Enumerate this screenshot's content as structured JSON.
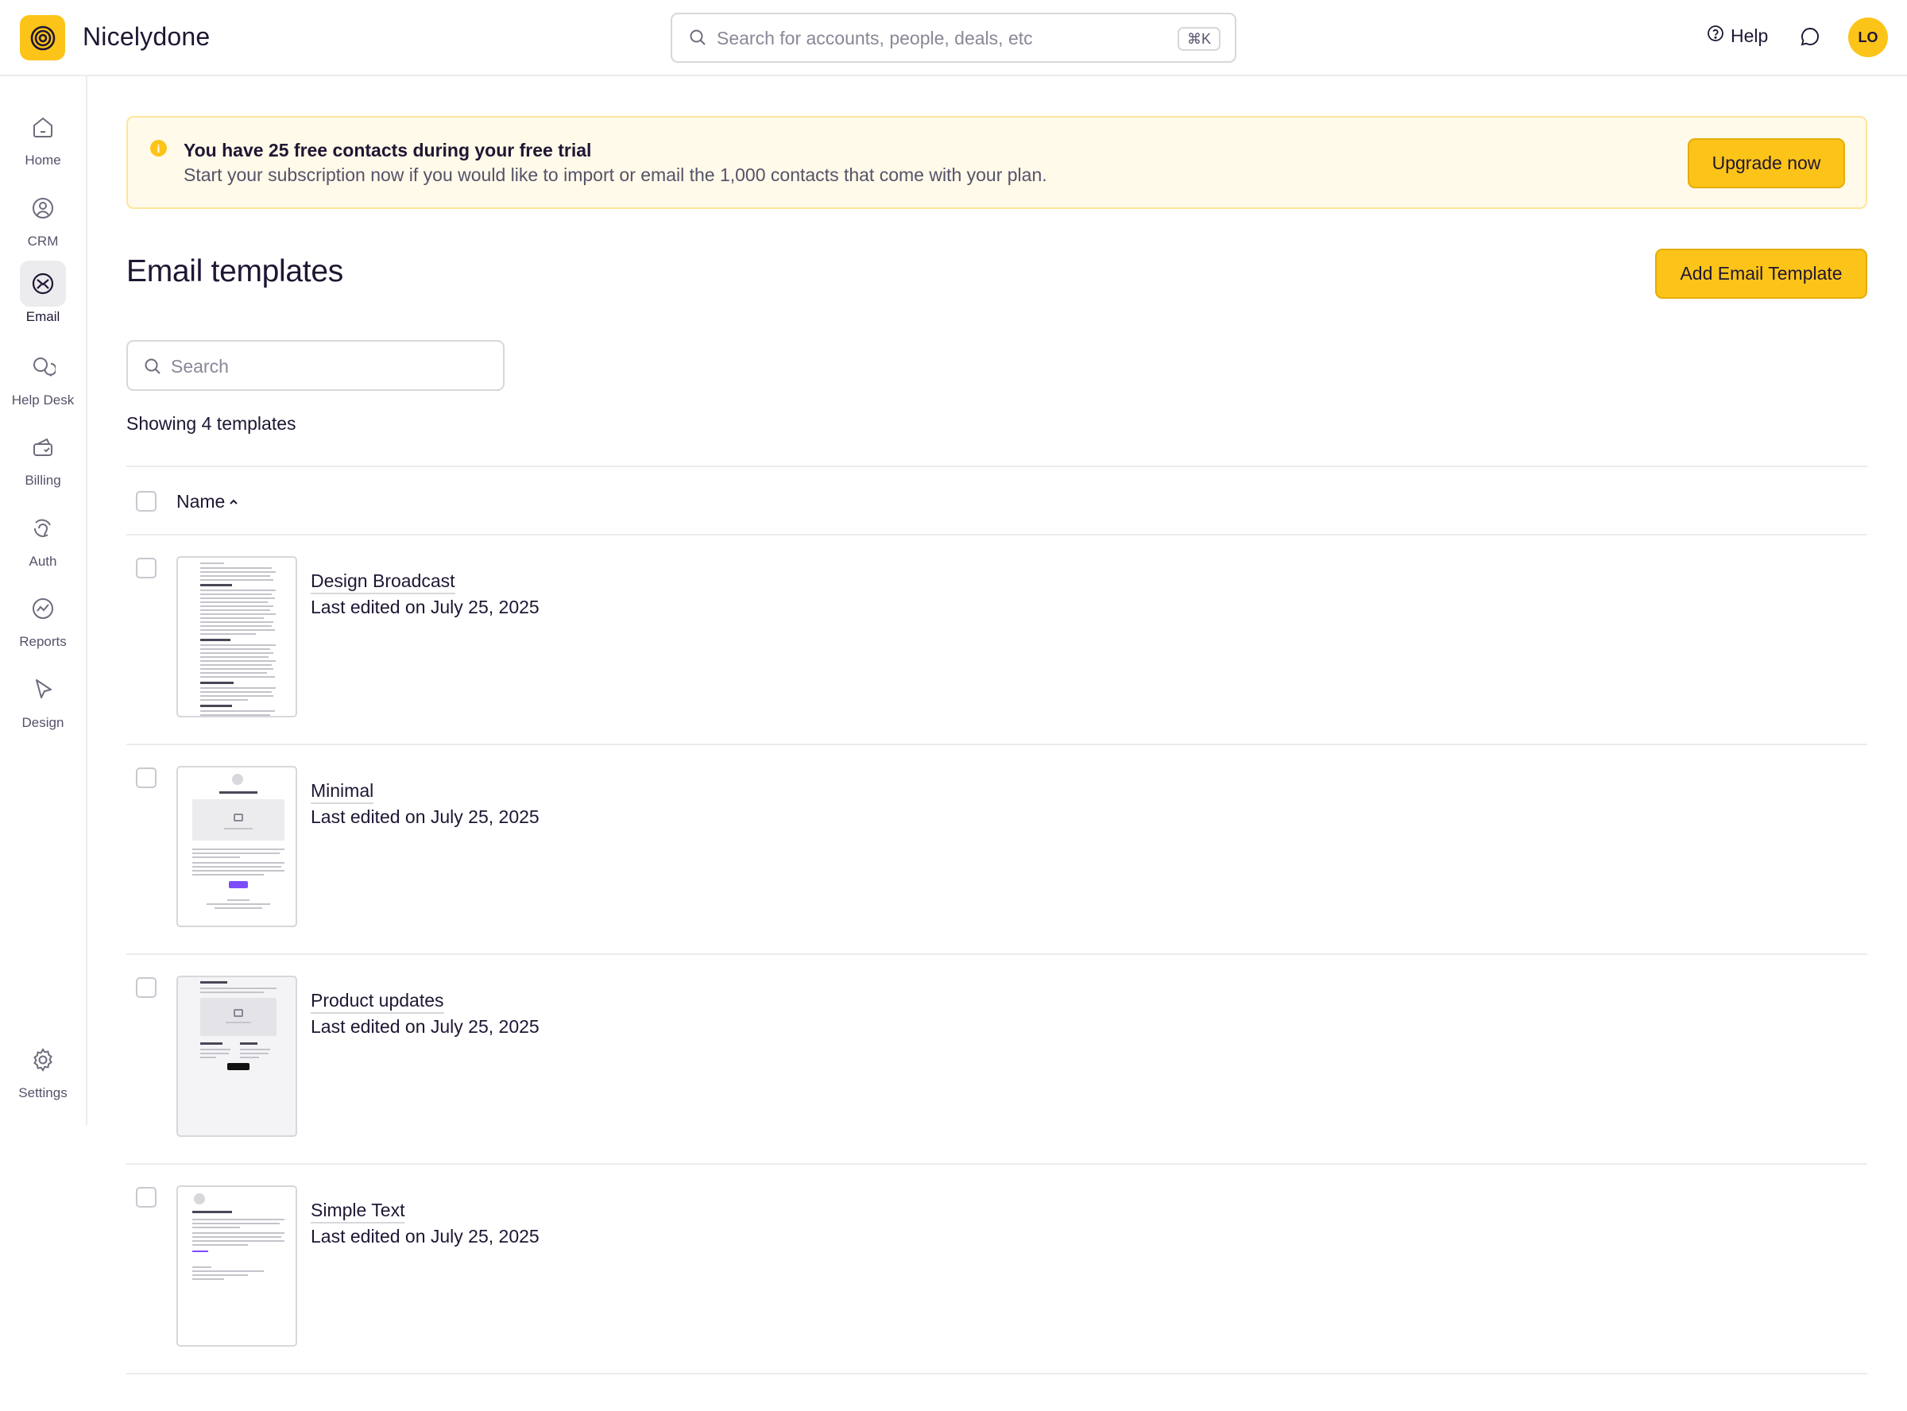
{
  "app": {
    "name": "Nicelydone",
    "logo_icon": "spiral-icon",
    "brand_color": "#fcc419"
  },
  "header": {
    "search_placeholder": "Search for accounts, people, deals, etc",
    "search_shortcut": "⌘K",
    "help_label": "Help",
    "avatar_initials": "LO"
  },
  "sidebar": {
    "items": [
      {
        "label": "Home",
        "icon": "home-icon",
        "active": false
      },
      {
        "label": "CRM",
        "icon": "user-circle-icon",
        "active": false
      },
      {
        "label": "Email",
        "icon": "email-icon",
        "active": true
      },
      {
        "label": "Help Desk",
        "icon": "chat-bubbles-icon",
        "active": false
      },
      {
        "label": "Billing",
        "icon": "billing-icon",
        "active": false
      },
      {
        "label": "Auth",
        "icon": "fingerprint-icon",
        "active": false
      },
      {
        "label": "Reports",
        "icon": "chart-icon",
        "active": false
      },
      {
        "label": "Design",
        "icon": "cursor-icon",
        "active": false
      }
    ],
    "settings_label": "Settings"
  },
  "banner": {
    "title": "You have 25 free contacts during your free trial",
    "text": "Start your subscription now if you would like to import or email the 1,000 contacts that come with your plan.",
    "button_label": "Upgrade now"
  },
  "page": {
    "title": "Email templates",
    "add_button_label": "Add Email Template",
    "search_placeholder": "Search",
    "count_text": "Showing 4 templates",
    "column_name": "Name"
  },
  "templates": [
    {
      "name": "Design Broadcast",
      "meta": "Last edited on July 25, 2025"
    },
    {
      "name": "Minimal",
      "meta": "Last edited on July 25, 2025"
    },
    {
      "name": "Product updates",
      "meta": "Last edited on July 25, 2025"
    },
    {
      "name": "Simple Text",
      "meta": "Last edited on July 25, 2025"
    }
  ]
}
